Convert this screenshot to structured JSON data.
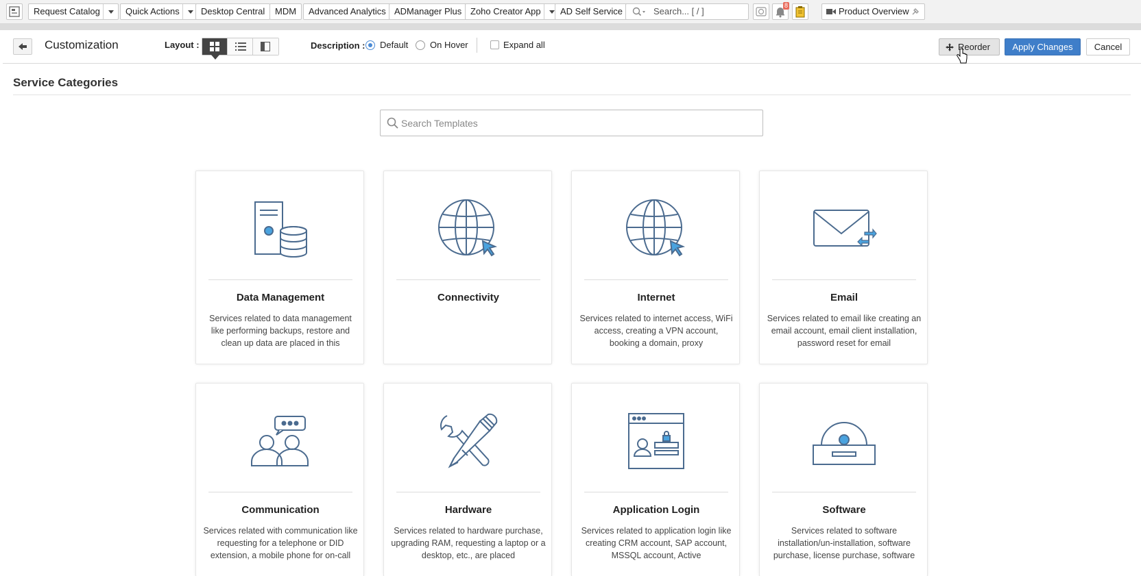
{
  "toolbar": {
    "request_catalog": "Request Catalog",
    "quick_actions": "Quick Actions",
    "desktop_central": "Desktop Central",
    "mdm": "MDM",
    "advanced_analytics": "Advanced Analytics",
    "admanager_plus": "ADManager Plus",
    "zoho_creator_app": "Zoho Creator App",
    "ad_self_service": "AD Self Service",
    "search_placeholder": "Search... [ / ]",
    "notification_count": "8",
    "product_overview": "Product Overview"
  },
  "header": {
    "title": "Customization",
    "layout_label": "Layout :",
    "description_label": "Description :",
    "desc_default": "Default",
    "desc_on_hover": "On Hover",
    "expand_all": "Expand all",
    "reorder": "Reorder",
    "apply_changes": "Apply Changes",
    "cancel": "Cancel"
  },
  "main": {
    "section_title": "Service Categories",
    "search_placeholder": "Search Templates",
    "categories": [
      {
        "title": "Data Management",
        "desc": "Services related to data management like performing backups, restore and clean up data are placed in this",
        "icon": "data-management-icon"
      },
      {
        "title": "Connectivity",
        "desc": "",
        "icon": "globe-cursor-icon"
      },
      {
        "title": "Internet",
        "desc": "Services related to internet access, WiFi access, creating a VPN account, booking a domain, proxy",
        "icon": "globe-cursor-icon"
      },
      {
        "title": "Email",
        "desc": "Services related to email like creating an email account, email client installation, password reset for email",
        "icon": "envelope-icon"
      },
      {
        "title": "Communication",
        "desc": "Services related with communication like requesting for a telephone or DID extension, a mobile phone for on-call",
        "icon": "people-chat-icon"
      },
      {
        "title": "Hardware",
        "desc": "Services related to hardware purchase, upgrading RAM, requesting a laptop or a desktop, etc., are placed",
        "icon": "wrench-screwdriver-icon"
      },
      {
        "title": "Application Login",
        "desc": "Services related to application login like creating CRM account, SAP account, MSSQL account, Active",
        "icon": "app-login-icon"
      },
      {
        "title": "Software",
        "desc": "Services related to software installation/un-installation, software purchase, license purchase, software",
        "icon": "disc-drive-icon"
      }
    ]
  },
  "colors": {
    "accent": "#3f7ec9",
    "icon_stroke": "#4b6b8f",
    "icon_fill": "#4aa3df",
    "badge": "#e96b5b"
  }
}
